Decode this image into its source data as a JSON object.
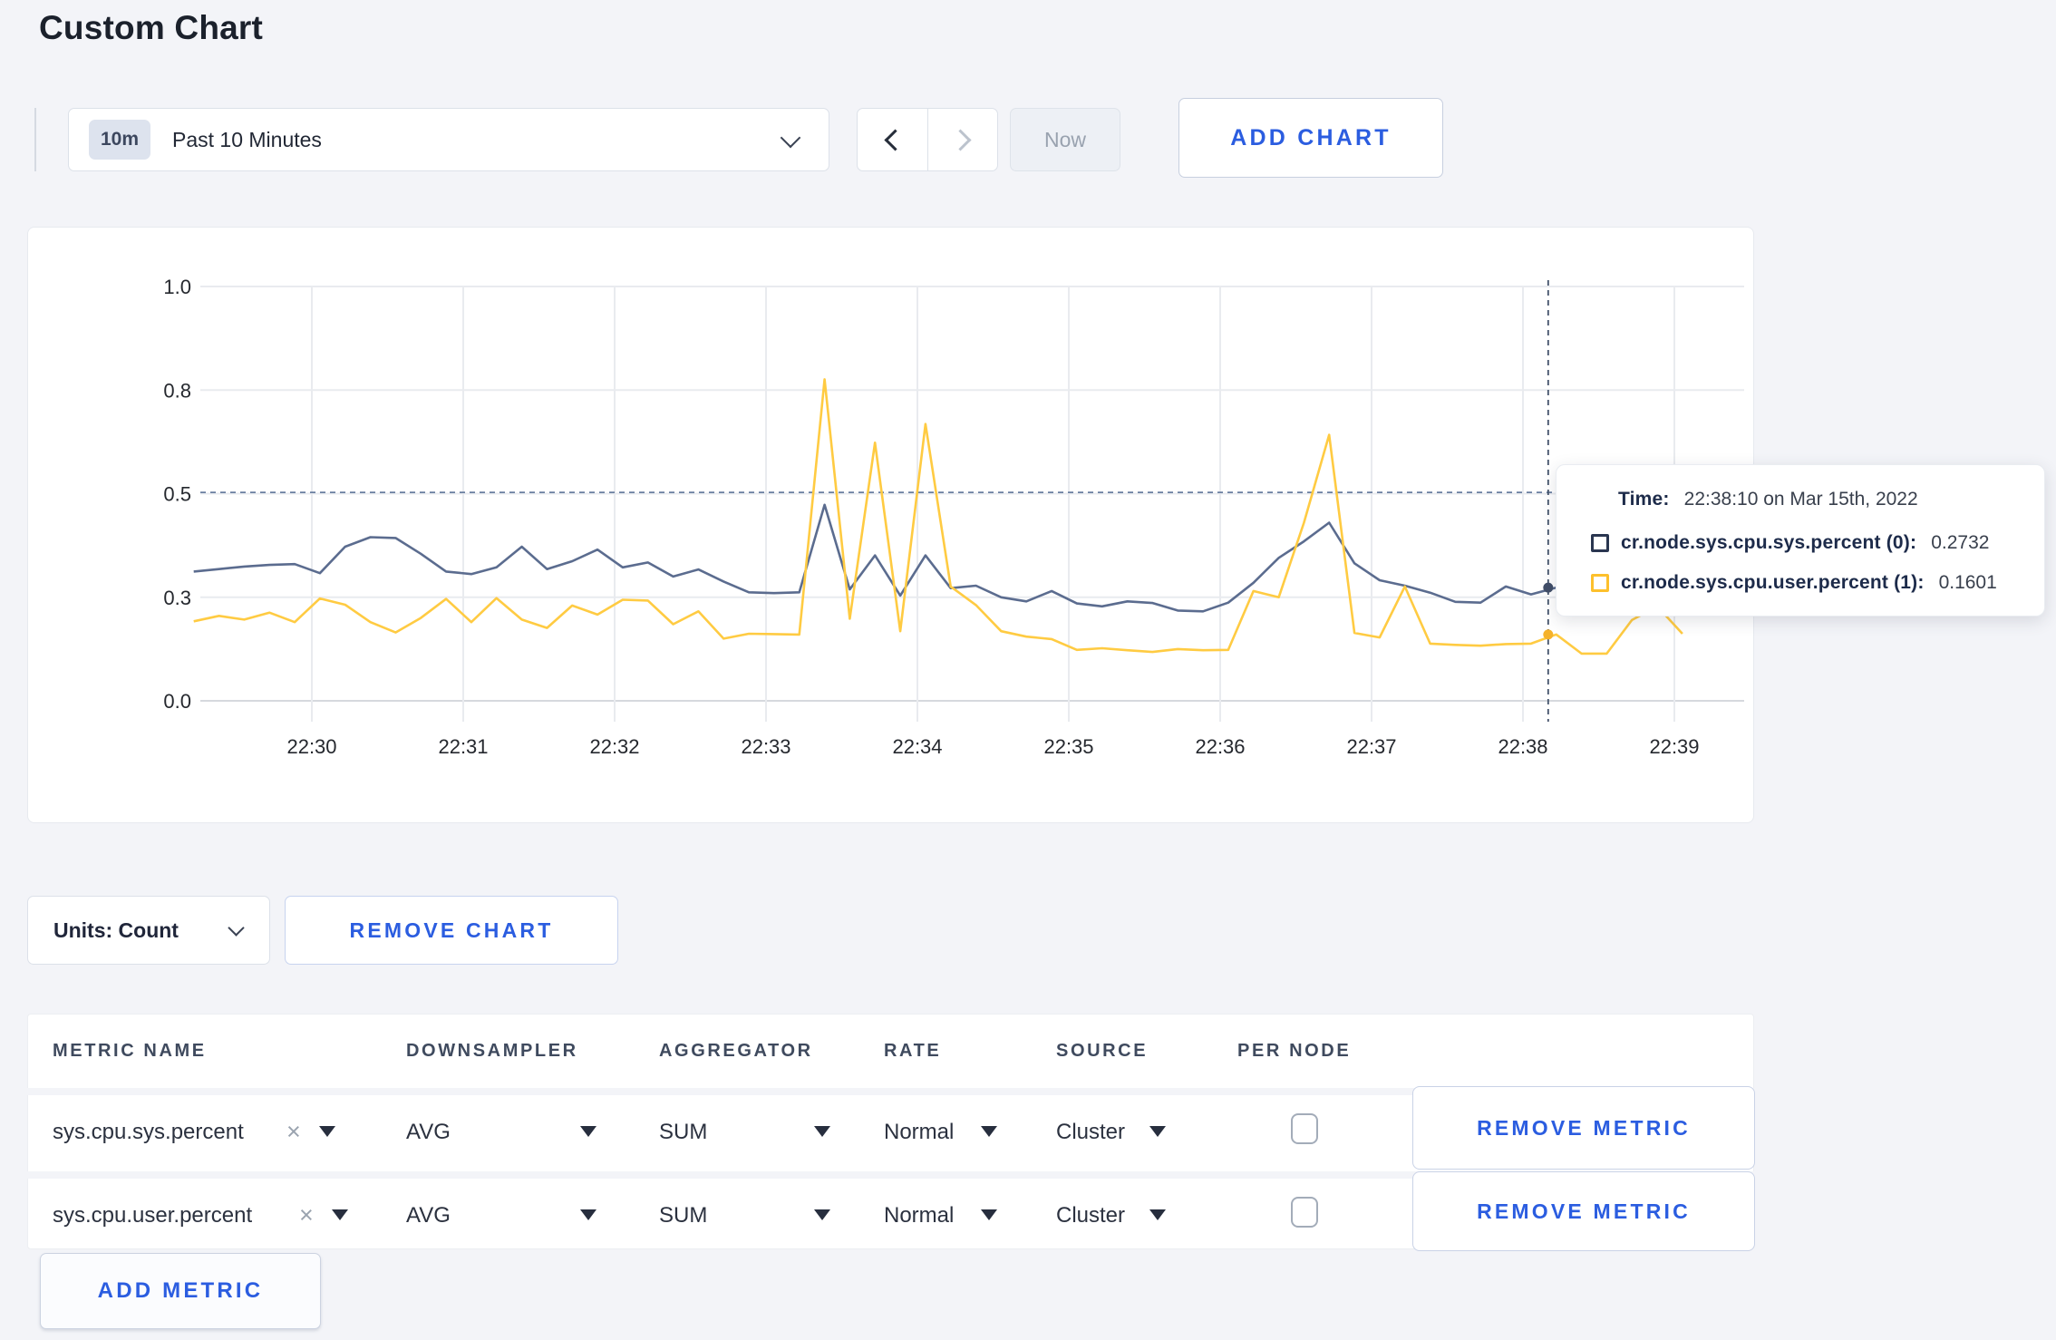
{
  "page": {
    "title": "Custom Chart"
  },
  "toolbar": {
    "range_badge": "10m",
    "range_label": "Past 10 Minutes",
    "now_label": "Now",
    "add_chart_label": "ADD CHART"
  },
  "colors": {
    "accent_blue": "#2b5de0",
    "series_sys_line": "#5b6c8f",
    "series_user_line": "#ffcb42",
    "swatch_sys": "#2a3650",
    "swatch_user": "#fdc02c",
    "grid": "#e9ebef",
    "page_background": "#f3f4f8"
  },
  "chart_data": {
    "type": "line",
    "title": "",
    "xlabel": "",
    "ylabel": "",
    "ylim": [
      0,
      1.0
    ],
    "grid": true,
    "legend_position": "tooltip-only",
    "x_tick_labels": [
      "22:30",
      "22:31",
      "22:32",
      "22:33",
      "22:34",
      "22:35",
      "22:36",
      "22:37",
      "22:38",
      "22:39"
    ],
    "y_tick_values": [
      0,
      0.25,
      0.5,
      0.75,
      1.0
    ],
    "y_tick_labels": [
      "0.0",
      "0.3",
      "0.5",
      "0.8",
      "1.0"
    ],
    "start_time": "22:29:13",
    "start_offset_min": -0.78,
    "interval_seconds": 10,
    "series": [
      {
        "name": "cr.node.sys.cpu.sys.percent (0)",
        "color": "#5b6c8f",
        "values": [
          0.312,
          0.318,
          0.324,
          0.328,
          0.33,
          0.308,
          0.372,
          0.395,
          0.393,
          0.355,
          0.312,
          0.306,
          0.322,
          0.372,
          0.318,
          0.337,
          0.365,
          0.322,
          0.334,
          0.3,
          0.317,
          0.288,
          0.262,
          0.26,
          0.262,
          0.473,
          0.269,
          0.351,
          0.254,
          0.351,
          0.272,
          0.278,
          0.25,
          0.24,
          0.265,
          0.235,
          0.228,
          0.24,
          0.236,
          0.218,
          0.216,
          0.237,
          0.285,
          0.345,
          0.385,
          0.43,
          0.332,
          0.291,
          0.278,
          0.261,
          0.239,
          0.237,
          0.276,
          0.257,
          0.2732,
          0.268,
          0.262,
          0.272,
          0.266,
          0.27
        ]
      },
      {
        "name": "cr.node.sys.cpu.user.percent (1)",
        "color": "#ffcb42",
        "values": [
          0.192,
          0.205,
          0.196,
          0.213,
          0.19,
          0.247,
          0.232,
          0.19,
          0.165,
          0.2,
          0.246,
          0.19,
          0.248,
          0.196,
          0.176,
          0.23,
          0.208,
          0.244,
          0.242,
          0.185,
          0.216,
          0.15,
          0.162,
          0.161,
          0.16,
          0.776,
          0.198,
          0.623,
          0.168,
          0.668,
          0.276,
          0.231,
          0.168,
          0.155,
          0.149,
          0.123,
          0.127,
          0.122,
          0.118,
          0.125,
          0.122,
          0.123,
          0.265,
          0.25,
          0.43,
          0.642,
          0.164,
          0.153,
          0.276,
          0.138,
          0.135,
          0.133,
          0.137,
          0.138,
          0.1601,
          0.114,
          0.114,
          0.195,
          0.228,
          0.162
        ]
      }
    ]
  },
  "crosshair": {
    "time_offset_min": 8.1667,
    "hline_value": 0.503,
    "points": [
      {
        "value": 0.2732,
        "dot_color": "#414e68"
      },
      {
        "value": 0.1601,
        "dot_color": "#f5b22b"
      }
    ]
  },
  "tooltip": {
    "time_label": "Time:",
    "time_value": "22:38:10 on Mar 15th, 2022",
    "rows": [
      {
        "label": "cr.node.sys.cpu.sys.percent (0):",
        "value": "0.2732"
      },
      {
        "label": "cr.node.sys.cpu.user.percent (1):",
        "value": "0.1601"
      }
    ]
  },
  "chart_footer": {
    "units_label": "Units: Count",
    "remove_chart_label": "REMOVE CHART"
  },
  "metrics_table": {
    "columns": [
      "METRIC NAME",
      "DOWNSAMPLER",
      "AGGREGATOR",
      "RATE",
      "SOURCE",
      "PER NODE"
    ],
    "close_glyph": "×",
    "rows": [
      {
        "metric": "sys.cpu.sys.percent",
        "downsampler": "AVG",
        "aggregator": "SUM",
        "rate": "Normal",
        "source": "Cluster",
        "per_node_checked": false,
        "remove_label": "REMOVE METRIC"
      },
      {
        "metric": "sys.cpu.user.percent",
        "downsampler": "AVG",
        "aggregator": "SUM",
        "rate": "Normal",
        "source": "Cluster",
        "per_node_checked": false,
        "remove_label": "REMOVE METRIC"
      }
    ],
    "add_metric_label": "ADD METRIC"
  }
}
